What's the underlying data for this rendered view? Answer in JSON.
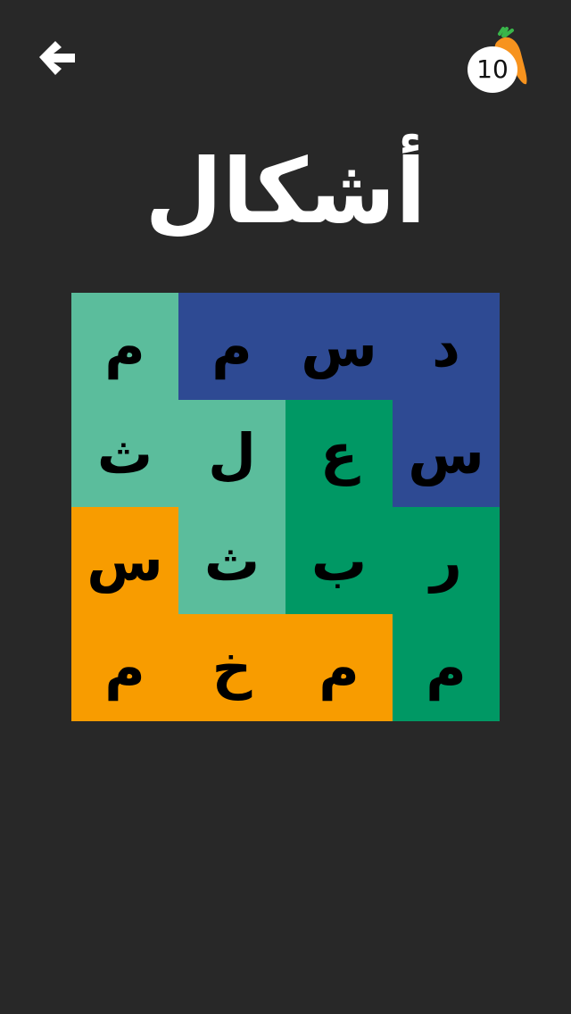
{
  "header": {
    "back_icon": "arrow-left-icon",
    "coin_count": "10",
    "coin_icon": "carrot-icon"
  },
  "title": "أشكال",
  "colors": {
    "background": "#282828",
    "teal": "#5bbd9c",
    "navy": "#2e4a93",
    "green": "#009864",
    "orange": "#f89c00",
    "carrot": "#f7931e",
    "carrot_leaf": "#39b54a"
  },
  "grid": {
    "rows": [
      [
        {
          "letter": "م",
          "color": "#5bbd9c"
        },
        {
          "letter": "م",
          "color": "#2e4a93"
        },
        {
          "letter": "س",
          "color": "#2e4a93"
        },
        {
          "letter": "د",
          "color": "#2e4a93"
        }
      ],
      [
        {
          "letter": "ث",
          "color": "#5bbd9c"
        },
        {
          "letter": "ل",
          "color": "#5bbd9c"
        },
        {
          "letter": "ع",
          "color": "#009864"
        },
        {
          "letter": "س",
          "color": "#2e4a93"
        }
      ],
      [
        {
          "letter": "س",
          "color": "#f89c00"
        },
        {
          "letter": "ث",
          "color": "#5bbd9c"
        },
        {
          "letter": "ب",
          "color": "#009864"
        },
        {
          "letter": "ر",
          "color": "#009864"
        }
      ],
      [
        {
          "letter": "م",
          "color": "#f89c00"
        },
        {
          "letter": "خ",
          "color": "#f89c00"
        },
        {
          "letter": "م",
          "color": "#f89c00"
        },
        {
          "letter": "م",
          "color": "#009864"
        }
      ]
    ]
  }
}
